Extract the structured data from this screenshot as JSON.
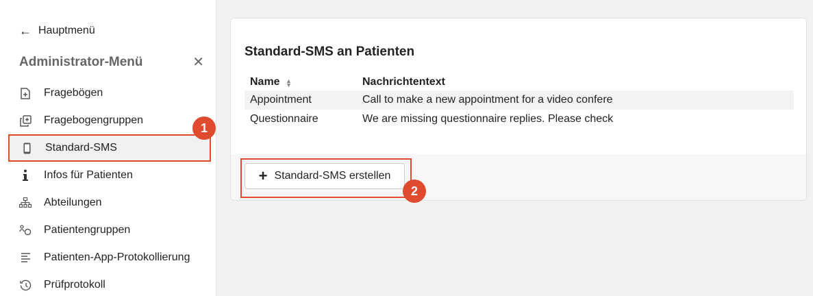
{
  "sidebar": {
    "back_label": "Hauptmenü",
    "admin_title": "Administrator-Menü",
    "close_symbol": "✕",
    "items": [
      {
        "label": "Fragebögen",
        "icon": "add-document-icon"
      },
      {
        "label": "Fragebogengruppen",
        "icon": "copy-documents-icon"
      },
      {
        "label": "Standard-SMS",
        "icon": "phone-icon",
        "active": true
      },
      {
        "label": "Infos für Patienten",
        "icon": "info-icon"
      },
      {
        "label": "Abteilungen",
        "icon": "org-chart-icon"
      },
      {
        "label": "Patientengruppen",
        "icon": "group-icon"
      },
      {
        "label": "Patienten-App-Protokollierung",
        "icon": "list-lines-icon"
      },
      {
        "label": "Prüfprotokoll",
        "icon": "history-icon"
      }
    ]
  },
  "annotations": {
    "badge1": "1",
    "badge2": "2"
  },
  "main": {
    "card_title": "Standard-SMS an Patienten",
    "table": {
      "headers": {
        "name": "Name",
        "text": "Nachrichtentext"
      },
      "rows": [
        {
          "name": "Appointment",
          "text": "Call to make a new appointment for a video confere"
        },
        {
          "name": "Questionnaire",
          "text": "We are missing questionnaire replies. Please check"
        }
      ]
    },
    "create_button_label": "Standard-SMS erstellen"
  },
  "colors": {
    "accent": "#e04a2f",
    "active_bg": "#f1f1f1"
  }
}
